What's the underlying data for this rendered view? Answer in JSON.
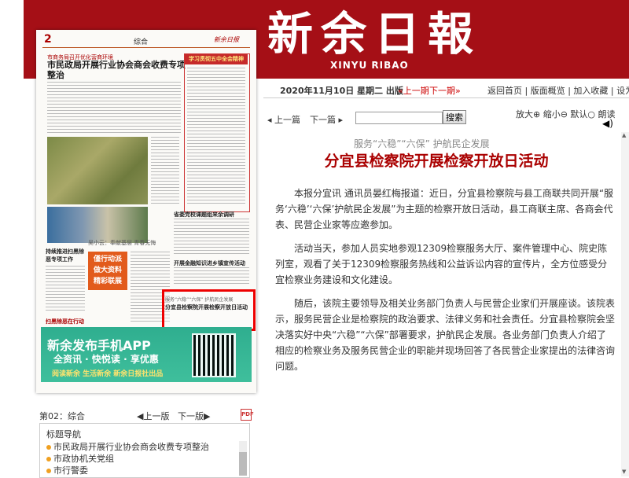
{
  "masthead": {
    "title": "新余日報",
    "pinyin": "XINYU RIBAO"
  },
  "paper": {
    "page_no": "2",
    "section": "综合",
    "mast_small": "新余日报",
    "head1": "市商务局召开优化营商环境",
    "head2": "市民政局开展行业协会商会收费专项整治",
    "red_bar": "学习贯彻五中全会精神",
    "side_title1": "省委党校课题组来余调研",
    "side_title2": "开展金融知识进乡镇宣传活动",
    "left_title": "持续推进扫黑除恶专项工作",
    "left_bottom": "扫黑除恶在行动",
    "caption": "吴小云：奉献基层 青春无悔",
    "poem": "",
    "orange_box": "僅行动派\n做大资料\n精彩联展",
    "highlight_kicker": "服务“六稳”“六保” 护航民企发展",
    "highlight_title": "分宜县检察院开展检察开放日活动",
    "ad_title": "新余发布手机APP",
    "ad_sub": "全资讯 · 快悦读 · 享优惠",
    "ad_foot": "阅读新余 生活新余   新余日报社出品"
  },
  "page_nav": {
    "label": "第02：综合",
    "prev": "◀上一版",
    "next": "下一版▶",
    "pdf": "PDF"
  },
  "title_nav": {
    "header": "标题导航",
    "items": [
      "市民政局开展行业协会商会收费专项整治",
      "市政协机关党组",
      "市行警委"
    ]
  },
  "issue": {
    "date": "2020年11月10日 星期二 出版",
    "prev": "«上一期",
    "next": "下一期»",
    "links": "返回首页 | 版面概览 | 加入收藏 | 设为首页"
  },
  "article_nav": {
    "prev": "◂ 上一篇",
    "next": "下一篇 ▸",
    "search_placeholder": "",
    "search_label": "搜索"
  },
  "zoom": {
    "label": "放大⊕ 缩小⊖ 默认○  朗读"
  },
  "article": {
    "kicker": "服务“六稳”“六保” 护航民企发展",
    "headline": "分宜县检察院开展检察开放日活动",
    "paragraphs": [
      "本报分宜讯 通讯员晏红梅报道：近日，分宜县检察院与县工商联共同开展“服务‘六稳’‘六保’护航民企发展”为主题的检察开放日活动，县工商联主席、各商会代表、民营企业家等应邀参加。",
      "活动当天，参加人员实地参观12309检察服务大厅、案件管理中心、院史陈列室，观看了关于12309检察服务热线和公益诉讼内容的宣传片，全方位感受分宜检察业务建设和文化建设。",
      "随后，该院主要领导及相关业务部门负责人与民营企业家们开展座谈。该院表示，服务民营企业是检察院的政治要求、法律义务和社会责任。分宜县检察院会坚决落实好中央“六稳”“六保”部署要求，护航民企发展。各业务部门负责人介绍了相应的检察业务及服务民营企业的职能并现场回答了各民营企业家提出的法律咨询问题。"
    ]
  },
  "colors": {
    "brand_red": "#a50f16",
    "headline_red": "#aa0000",
    "ad_green": "#2fae8f"
  }
}
